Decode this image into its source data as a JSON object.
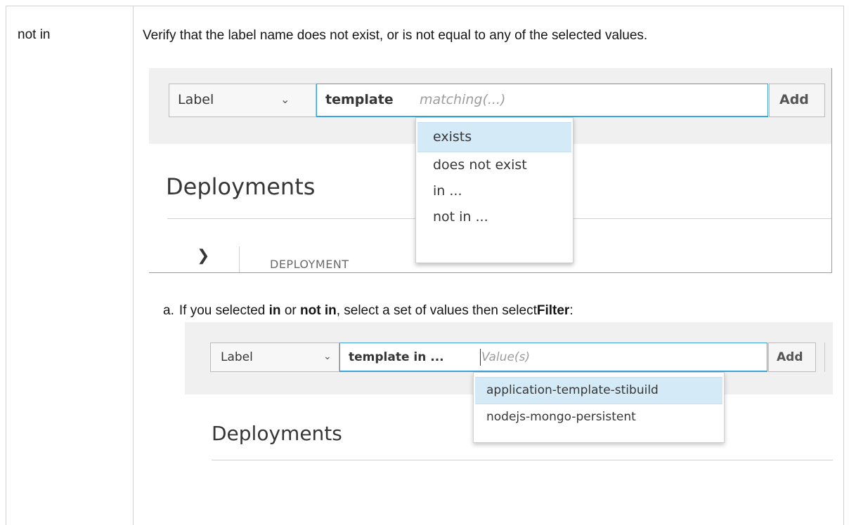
{
  "table": {
    "term": "not in",
    "description": "Verify that the label name does not exist, or is not equal to any of the selected values."
  },
  "screenshot1": {
    "filter_type_select": "Label",
    "filter_key": "template",
    "filter_placeholder": "matching(...)",
    "add_button": "Add",
    "operator_options": [
      "exists",
      "does not exist",
      "in ...",
      "not in ..."
    ],
    "selected_option_index": 0,
    "page_heading": "Deployments",
    "column_header": "DEPLOYMENT"
  },
  "step": {
    "marker": "a.",
    "text_1": "If you selected ",
    "in": "in",
    "or": " or ",
    "not_in": "not in",
    "text_2": ", select a set of values then select",
    "filter": "Filter",
    "colon": ":"
  },
  "screenshot2": {
    "filter_type_select": "Label",
    "filter_key": "template   in ...",
    "filter_placeholder": "Value(s)",
    "add_button": "Add",
    "value_options": [
      "application-template-stibuild",
      "nodejs-mongo-persistent"
    ],
    "selected_option_index": 0,
    "page_heading": "Deployments"
  },
  "icons": {
    "select_chevron": "chevron-down-icon",
    "row_expand": "chevron-right-icon"
  },
  "colors": {
    "focus_border": "#39a5dc",
    "option_highlight": "#d4eaf7",
    "toolbar_bg": "#f0f0f0"
  }
}
